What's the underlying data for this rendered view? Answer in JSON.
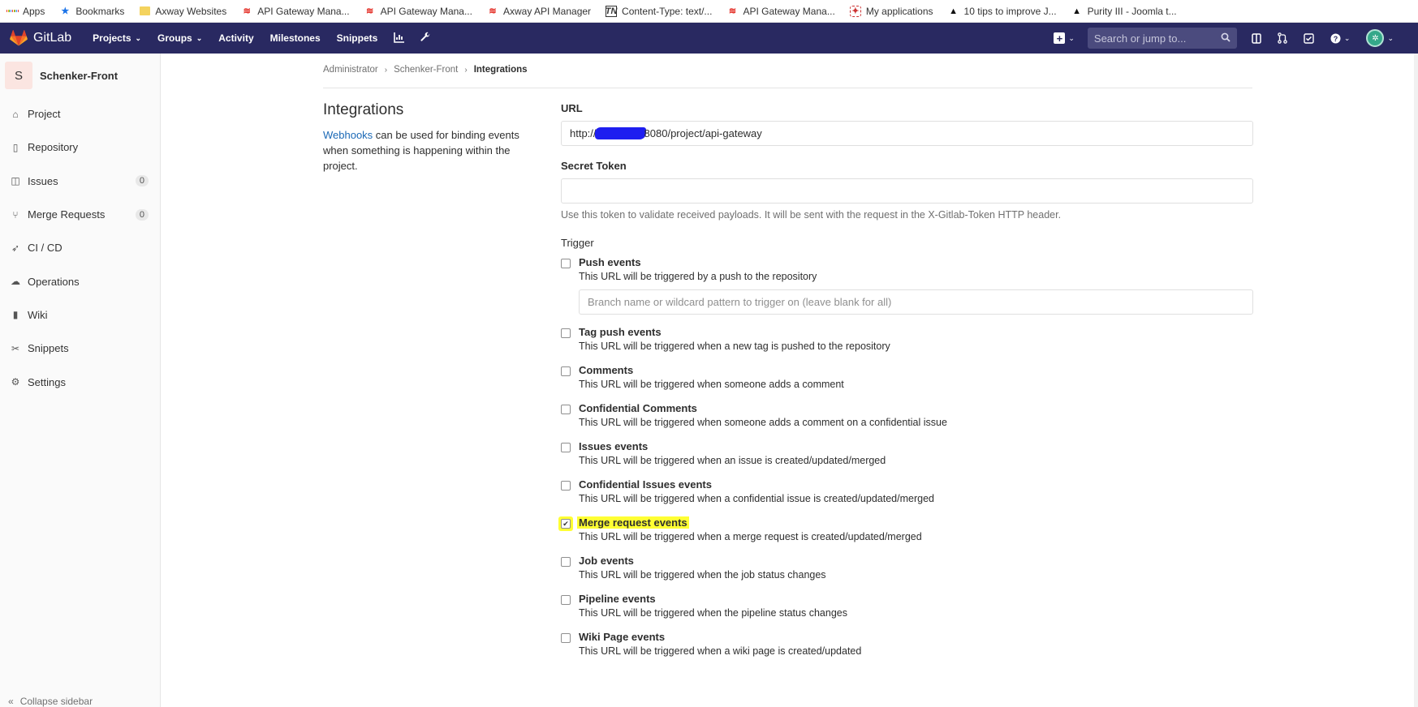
{
  "bookmarks": [
    {
      "label": "Apps",
      "icon": "apps-grid-icon"
    },
    {
      "label": "Bookmarks",
      "icon": "star-icon"
    },
    {
      "label": "Axway Websites",
      "icon": "folder-icon"
    },
    {
      "label": "API Gateway Mana...",
      "icon": "axway-icon"
    },
    {
      "label": "API Gateway Mana...",
      "icon": "axway-icon"
    },
    {
      "label": "Axway API Manager",
      "icon": "axway-icon"
    },
    {
      "label": "Content-Type: text/...",
      "icon": "tn-icon"
    },
    {
      "label": "API Gateway Mana...",
      "icon": "axway-icon"
    },
    {
      "label": "My applications",
      "icon": "my-applications-icon"
    },
    {
      "label": "10 tips to improve J...",
      "icon": "peak-icon"
    },
    {
      "label": "Purity III - Joomla t...",
      "icon": "peak-icon"
    }
  ],
  "navbar": {
    "brand": "GitLab",
    "links": [
      "Projects",
      "Groups",
      "Activity",
      "Milestones",
      "Snippets"
    ],
    "search_placeholder": "Search or jump to..."
  },
  "sidebar": {
    "project_initial": "S",
    "project_name": "Schenker-Front",
    "items": [
      {
        "label": "Project",
        "icon": "home-icon"
      },
      {
        "label": "Repository",
        "icon": "doc-icon"
      },
      {
        "label": "Issues",
        "icon": "issues-icon",
        "count": "0"
      },
      {
        "label": "Merge Requests",
        "icon": "merge-request-icon",
        "count": "0"
      },
      {
        "label": "CI / CD",
        "icon": "rocket-icon"
      },
      {
        "label": "Operations",
        "icon": "cloud-icon"
      },
      {
        "label": "Wiki",
        "icon": "book-icon"
      },
      {
        "label": "Snippets",
        "icon": "scissors-icon"
      },
      {
        "label": "Settings",
        "icon": "gear-icon"
      }
    ],
    "collapse_label": "Collapse sidebar"
  },
  "breadcrumb": {
    "items": [
      "Administrator",
      "Schenker-Front"
    ],
    "current": "Integrations"
  },
  "page": {
    "title": "Integrations",
    "desc_link": "Webhooks",
    "desc_rest": " can be used for binding events when something is happening within the project."
  },
  "form": {
    "url_label": "URL",
    "url_prefix": "http://",
    "url_suffix": "8080/project/api-gateway",
    "secret_label": "Secret Token",
    "secret_value": "",
    "secret_help": "Use this token to validate received payloads. It will be sent with the request in the X-Gitlab-Token HTTP header.",
    "trigger_label": "Trigger",
    "branch_placeholder": "Branch name or wildcard pattern to trigger on (leave blank for all)",
    "triggers": [
      {
        "label": "Push events",
        "help": "This URL will be triggered by a push to the repository",
        "checked": false
      },
      {
        "label": "Tag push events",
        "help": "This URL will be triggered when a new tag is pushed to the repository",
        "checked": false
      },
      {
        "label": "Comments",
        "help": "This URL will be triggered when someone adds a comment",
        "checked": false
      },
      {
        "label": "Confidential Comments",
        "help": "This URL will be triggered when someone adds a comment on a confidential issue",
        "checked": false
      },
      {
        "label": "Issues events",
        "help": "This URL will be triggered when an issue is created/updated/merged",
        "checked": false
      },
      {
        "label": "Confidential Issues events",
        "help": "This URL will be triggered when a confidential issue is created/updated/merged",
        "checked": false
      },
      {
        "label": "Merge request events",
        "help": "This URL will be triggered when a merge request is created/updated/merged",
        "checked": true
      },
      {
        "label": "Job events",
        "help": "This URL will be triggered when the job status changes",
        "checked": false
      },
      {
        "label": "Pipeline events",
        "help": "This URL will be triggered when the pipeline status changes",
        "checked": false
      },
      {
        "label": "Wiki Page events",
        "help": "This URL will be triggered when a wiki page is created/updated",
        "checked": false
      }
    ]
  },
  "colors": {
    "navbar_bg": "#292961",
    "link": "#1b69b6",
    "highlight": "#ffff33",
    "redaction": "#1e1ef0"
  }
}
